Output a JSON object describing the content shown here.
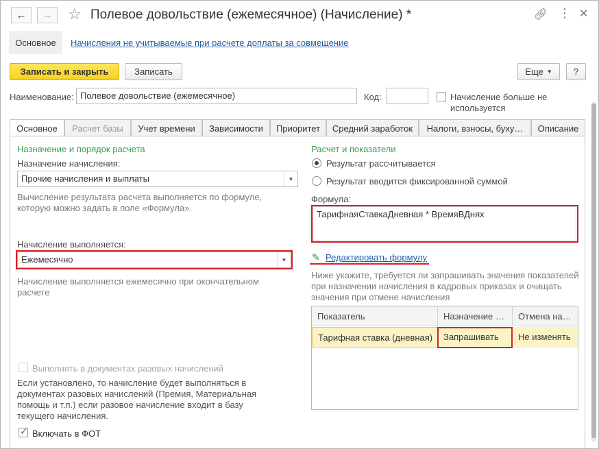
{
  "window": {
    "title": "Полевое довольствие (ежемесячное) (Начисление) *"
  },
  "subnav": {
    "main": "Основное",
    "link": "Начисления не учитываемые при расчете доплаты за совмещение"
  },
  "toolbar": {
    "save_close": "Записать и закрыть",
    "save": "Записать",
    "more": "Еще",
    "help": "?"
  },
  "form": {
    "name_label": "Наименование:",
    "name_value": "Полевое довольствие (ежемесячное)",
    "code_label": "Код:",
    "code_value": "",
    "unused_label_1": "Начисление больше не",
    "unused_label_2": "используется"
  },
  "tabs": [
    {
      "label": "Основное"
    },
    {
      "label": "Расчет базы"
    },
    {
      "label": "Учет времени"
    },
    {
      "label": "Зависимости"
    },
    {
      "label": "Приоритет"
    },
    {
      "label": "Средний заработок"
    },
    {
      "label": "Налоги, взносы, буху…"
    },
    {
      "label": "Описание"
    }
  ],
  "left": {
    "section_title": "Назначение и порядок расчета",
    "purpose_label": "Назначение начисления:",
    "purpose_value": "Прочие начисления и выплаты",
    "purpose_hint_1": "Вычисление результата расчета выполняется по формуле,",
    "purpose_hint_2": "которую можно задать в поле «Формула».",
    "period_label": "Начисление выполняется:",
    "period_value": "Ежемесячно",
    "period_hint_1": "Начисление выполняется ежемесячно при окончательном",
    "period_hint_2": "расчете",
    "onetime_label": "Выполнять в документах разовых начислений",
    "onetime_hint_1": "Если установлено, то начисление будет выполняться в",
    "onetime_hint_2": "документах разовых начислений (Премия, Материальная",
    "onetime_hint_3": "помощь и т.п.) если разовое начисление входит в базу",
    "onetime_hint_4": "текущего начисления.",
    "fot_label": "Включать в ФОТ"
  },
  "right": {
    "section_title": "Расчет и показатели",
    "radio_calc": "Результат рассчитывается",
    "radio_fixed": "Результат вводится фиксированной суммой",
    "formula_label": "Формула:",
    "formula_value": "ТарифнаяСтавкаДневная * ВремяВДнях",
    "edit_formula": "Редактировать формулу",
    "grid_hint_1": "Ниже укажите, требуется ли запрашивать значения показателей",
    "grid_hint_2": "при назначении начисления в кадровых приказах и очищать",
    "grid_hint_3": "значения при отмене начисления",
    "grid": {
      "columns": [
        "Показатель",
        "Назначение …",
        "Отмена на…"
      ],
      "rows": [
        [
          "Тарифная ставка (дневная)",
          "Запрашивать",
          "Не изменять"
        ]
      ]
    }
  },
  "colors": {
    "accent_yellow": "#f6d21e",
    "section_green": "#3c9f47",
    "highlight_red": "#d42026",
    "link_blue": "#245ea8",
    "row_highlight": "#fbf3c5"
  }
}
